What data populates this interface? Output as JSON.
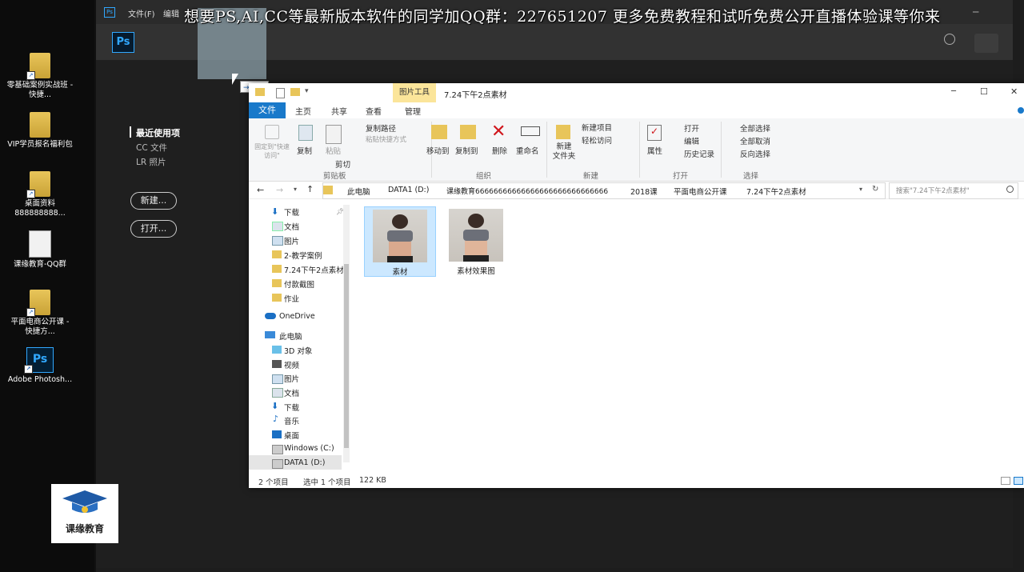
{
  "desktop": {
    "icons": [
      {
        "label": "零基础案例实战班 - 快捷...",
        "icon": "folder-icon"
      },
      {
        "label": "VIP学员报名福利包",
        "icon": "folder-icon"
      },
      {
        "label": "桌面资料888888888...",
        "icon": "folder-icon"
      },
      {
        "label": "课缘教育-QQ群",
        "icon": "document-icon"
      },
      {
        "label": "平面电商公开课 - 快捷方...",
        "icon": "folder-icon"
      },
      {
        "label": "Adobe Photosh...",
        "icon": "photoshop-icon"
      }
    ]
  },
  "photoshop": {
    "menu": [
      "文件(F)",
      "编辑"
    ],
    "logo": "Ps",
    "home": {
      "recent_heading": "最近使用项",
      "links": [
        "CC 文件",
        "LR 照片"
      ],
      "new_button": "新建...",
      "open_button": "打开..."
    }
  },
  "overlay": {
    "banner": "想要PS,AI,CC等最新版本软件的同学加QQ群：227651207 更多免费教程和试听免费公开直播体验课等你来",
    "drag_tooltip": "移动"
  },
  "explorer": {
    "context_tab": "图片工具",
    "title": "7.24下午2点素材",
    "window_controls": {
      "minimize": "─",
      "maximize": "☐",
      "close": "✕"
    },
    "tabs": [
      "文件",
      "主页",
      "共享",
      "查看",
      "管理"
    ],
    "ribbon": {
      "clipboard": {
        "pin": "固定到\"快速访问\"",
        "copy": "复制",
        "paste": "粘贴",
        "copy_path": "复制路径",
        "paste_shortcut": "粘贴快捷方式",
        "cut": "剪切",
        "label": "剪贴板"
      },
      "organize": {
        "move_to": "移动到",
        "copy_to": "复制到",
        "delete": "删除",
        "rename": "重命名",
        "label": "组织"
      },
      "new": {
        "new_folder": "新建\n文件夹",
        "new_item": "新建项目",
        "easy_access": "轻松访问",
        "label": "新建"
      },
      "open": {
        "properties": "属性",
        "open": "打开",
        "edit": "编辑",
        "history": "历史记录",
        "label": "打开"
      },
      "select": {
        "select_all": "全部选择",
        "select_none": "全部取消",
        "invert": "反向选择",
        "label": "选择"
      }
    },
    "address": {
      "crumbs": [
        "此电脑",
        "DATA1 (D:)",
        "课缘教育66666666666666666666666666666",
        "2018课",
        "平面电商公开课",
        "7.24下午2点素材"
      ],
      "search_placeholder": "搜索\"7.24下午2点素材\""
    },
    "nav": {
      "quick_access": [
        "下载",
        "文档",
        "图片",
        "2-教学案例",
        "7.24下午2点素材",
        "付款截图",
        "作业"
      ],
      "onedrive": "OneDrive",
      "this_pc": "此电脑",
      "pc_items": [
        "3D 对象",
        "视频",
        "图片",
        "文档",
        "下载",
        "音乐",
        "桌面",
        "Windows (C:)",
        "DATA1 (D:)"
      ]
    },
    "files": [
      {
        "name": "素材",
        "selected": true
      },
      {
        "name": "素材效果图",
        "selected": false
      }
    ],
    "status": {
      "count": "2 个项目",
      "selected": "选中 1 个项目",
      "size": "122 KB"
    }
  },
  "watermark": {
    "text": "课缘教育"
  }
}
